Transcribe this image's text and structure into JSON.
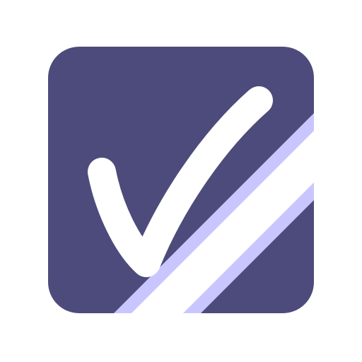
{
  "icon": {
    "name": "checkbox-checked-icon",
    "colors": {
      "background": "#ffffff",
      "tile": "#4d4b7b",
      "stripe_outer": "#c9c6ff",
      "stripe_inner": "#ffffff",
      "checkmark": "#ffffff"
    }
  }
}
